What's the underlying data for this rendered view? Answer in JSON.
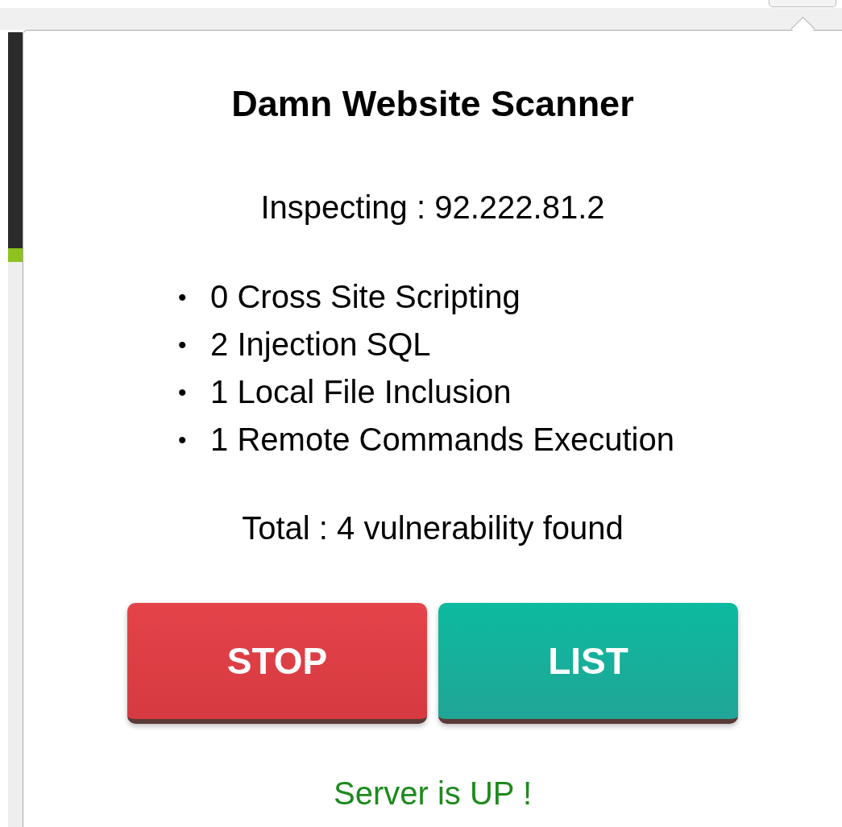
{
  "title": "Damn Website Scanner",
  "target": "Inspecting : 92.222.81.2",
  "findings": [
    {
      "marker": "•",
      "text": "0 Cross Site Scripting"
    },
    {
      "marker": "•",
      "text": "2 Injection SQL"
    },
    {
      "marker": "•",
      "text": "1 Local File Inclusion"
    },
    {
      "marker": "•",
      "text": "1 Remote Commands Execution"
    }
  ],
  "total": "Total : 4 vulnerability found",
  "buttons": [
    {
      "label": "STOP",
      "kind": "danger"
    },
    {
      "label": "LIST",
      "kind": "primary"
    }
  ],
  "status": {
    "text": "Server is UP !"
  }
}
